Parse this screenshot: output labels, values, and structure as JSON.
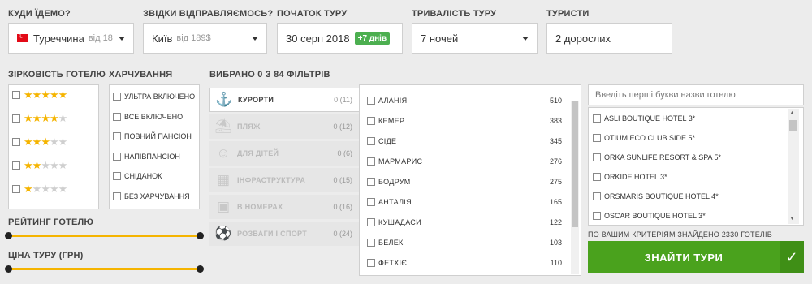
{
  "search_form": {
    "destination": {
      "label": "КУДИ ЇДЕМО?",
      "value": "Туреччина",
      "hint": "від 18"
    },
    "departure": {
      "label": "ЗВІДКИ ВІДПРАВЛЯЄМОСЬ?",
      "value": "Київ",
      "hint": "від 189$"
    },
    "start_date": {
      "label": "ПОЧАТОК ТУРУ",
      "value": "30 серп 2018",
      "badge": "+7 днів"
    },
    "duration": {
      "label": "ТРИВАЛІСТЬ ТУРУ",
      "value": "7 ночей"
    },
    "tourists": {
      "label": "ТУРИСТИ",
      "value": "2 дорослих"
    }
  },
  "hotel_stars": {
    "label": "ЗІРКОВІСТЬ ГОТЕЛЮ",
    "rows": [
      {
        "stars": 5
      },
      {
        "stars": 4
      },
      {
        "stars": 3
      },
      {
        "stars": 2
      },
      {
        "stars": 1
      }
    ]
  },
  "meals": {
    "label": "ХАРЧУВАННЯ",
    "items": [
      "УЛЬТРА ВКЛЮЧЕНО",
      "ВСЕ ВКЛЮЧЕНО",
      "ПОВНИЙ ПАНСІОН",
      "НАПІВПАНСІОН",
      "СНІДАНОК",
      "БЕЗ ХАРЧУВАННЯ"
    ]
  },
  "rating": {
    "label": "РЕЙТИНГ ГОТЕЛЮ",
    "min_fraction": 0,
    "max_fraction": 1
  },
  "price": {
    "label": "ЦІНА ТУРУ (ГРН)",
    "min_fraction": 0,
    "max_fraction": 1
  },
  "filters": {
    "summary": "ВИБРАНО 0 З 84 ФІЛЬТРІВ",
    "tabs": [
      {
        "name": "КУРОРТИ",
        "count": "0 (11)",
        "icon": "anchor-icon"
      },
      {
        "name": "ПЛЯЖ",
        "count": "0 (12)",
        "icon": "beach-icon"
      },
      {
        "name": "ДЛЯ ДІТЕЙ",
        "count": "0 (6)",
        "icon": "kids-icon"
      },
      {
        "name": "ІНФРАСТРУКТУРА",
        "count": "0 (15)",
        "icon": "building-icon"
      },
      {
        "name": "В НОМЕРАХ",
        "count": "0 (16)",
        "icon": "room-icon"
      },
      {
        "name": "РОЗВАГИ І СПОРТ",
        "count": "0 (24)",
        "icon": "sport-icon"
      }
    ],
    "resorts": [
      {
        "name": "АЛАНІЯ",
        "count": "510"
      },
      {
        "name": "КЕМЕР",
        "count": "383"
      },
      {
        "name": "СІДЕ",
        "count": "345"
      },
      {
        "name": "МАРМАРИС",
        "count": "276"
      },
      {
        "name": "БОДРУМ",
        "count": "275"
      },
      {
        "name": "АНТАЛІЯ",
        "count": "165"
      },
      {
        "name": "КУШАДАСИ",
        "count": "122"
      },
      {
        "name": "БЕЛЕК",
        "count": "103"
      },
      {
        "name": "ФЕТХІЄ",
        "count": "110"
      }
    ]
  },
  "hotels": {
    "search_placeholder": "Введіть перші букви назви готелю",
    "items": [
      "ASLI BOUTIQUE HOTEL 3*",
      "OTIUM ECO CLUB SIDE 5*",
      "ORKA SUNLIFE RESORT & SPA 5*",
      "ORKIDE HOTEL 3*",
      "ORSMARIS BOUTIQUE HOTEL 4*",
      "OSCAR BOUTIQUE HOTEL 3*"
    ],
    "found_text": "ПО ВАШИМ КРИТЕРІЯМ ЗНАЙДЕНО 2330 ГОТЕЛІВ"
  },
  "actions": {
    "search_label": "ЗНАЙТИ ТУРИ",
    "check_icon": "check-icon"
  },
  "colors": {
    "accent_green": "#4aa21d",
    "star_gold": "#f5b400",
    "badge_green": "#4caf50"
  }
}
